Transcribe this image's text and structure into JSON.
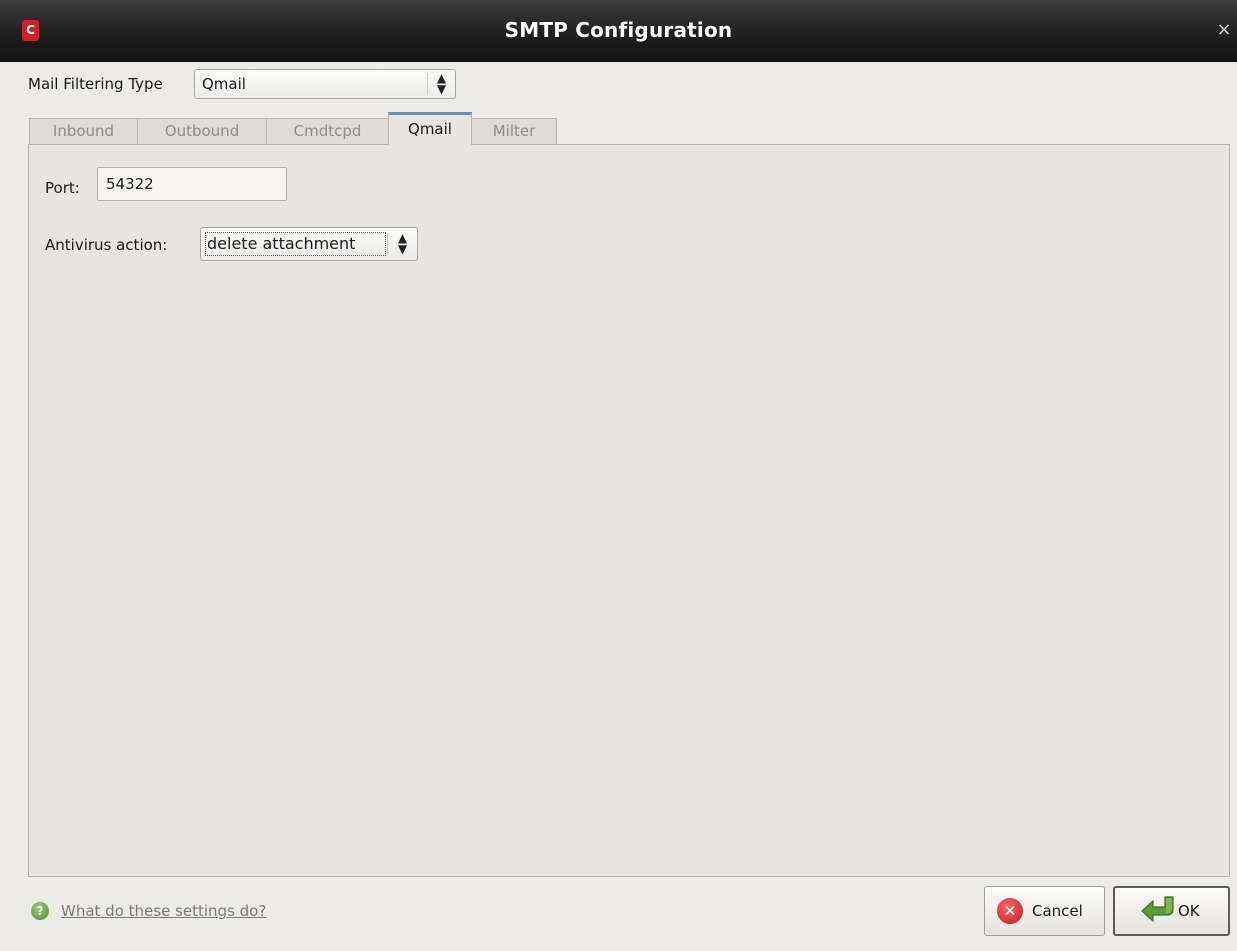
{
  "window": {
    "title": "SMTP Configuration",
    "logo_letter": "C",
    "close_glyph": "×"
  },
  "filter": {
    "label": "Mail Filtering Type",
    "selected": "Qmail",
    "arrow_glyph": "▲▼"
  },
  "tabs": [
    {
      "label": "Inbound",
      "active": false
    },
    {
      "label": "Outbound",
      "active": false
    },
    {
      "label": "Cmdtcpd",
      "active": false
    },
    {
      "label": "Qmail",
      "active": true
    },
    {
      "label": "Milter",
      "active": false
    }
  ],
  "qmail": {
    "port_label": "Port:",
    "port_value": "54322",
    "antivirus_label": "Antivirus action:",
    "antivirus_selected": "delete attachment"
  },
  "footer": {
    "help_text": "What do these settings do?",
    "cancel_label": "Cancel",
    "ok_label": "OK"
  },
  "icons": {
    "app": "app-logo-icon",
    "close": "close-icon",
    "help": "help-icon",
    "cancel": "cancel-icon",
    "ok": "ok-arrow-icon"
  },
  "colors": {
    "titlebar": "#1f1f1f",
    "window_bg": "#edebe7",
    "active_tab_accent": "#6e8fb4",
    "cancel_red": "#c8171b",
    "ok_green": "#5f9c3a",
    "help_green": "#4b8e2a"
  }
}
